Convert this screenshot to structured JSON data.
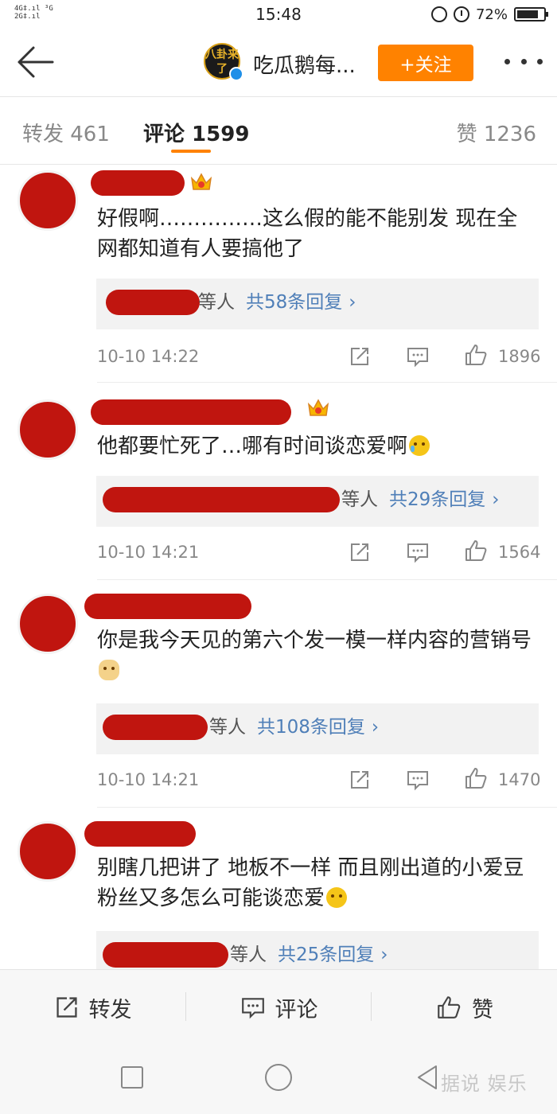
{
  "status_bar": {
    "network_top": "4G‡.ıl ³G",
    "network_bottom": "2G‡.ıl",
    "time": "15:48",
    "battery": "72%",
    "battery_level": 0.72
  },
  "header": {
    "avatar_text": "八卦来了",
    "title": "吃瓜鹅每...",
    "follow_label": "+关注"
  },
  "tabs": {
    "forward": "转发 461",
    "comments": "评论 1599",
    "likes": "赞 1236"
  },
  "comments": [
    {
      "text": "好假啊……………这么假的能不能别发 现在全网都知道有人要搞他了",
      "emoji": "",
      "reply_who": "等人",
      "reply_count": "共58条回复",
      "reply_arrow": "›",
      "time": "10-10 14:22",
      "likes": "1896"
    },
    {
      "text": "他都要忙死了…哪有时间谈恋爱啊",
      "emoji": "cry-laugh",
      "reply_who": "等人",
      "reply_count": "共29条回复",
      "reply_arrow": "›",
      "time": "10-10 14:21",
      "likes": "1564"
    },
    {
      "text": "你是我今天见的第六个发一模一样内容的营销号",
      "emoji": "doge",
      "reply_who": "等人",
      "reply_count": "共108条回复",
      "reply_arrow": "›",
      "time": "10-10 14:21",
      "likes": "1470"
    },
    {
      "text": "别瞎几把讲了 地板不一样 而且刚出道的小爱豆粉丝又多怎么可能谈恋爱",
      "emoji": "smug",
      "reply_who": "等人",
      "reply_count": "共25条回复",
      "reply_arrow": "›",
      "time": "",
      "likes": ""
    }
  ],
  "bottom_bar": {
    "forward": "转发",
    "comment": "评论",
    "like": "赞"
  },
  "watermark": "据说 娱乐"
}
